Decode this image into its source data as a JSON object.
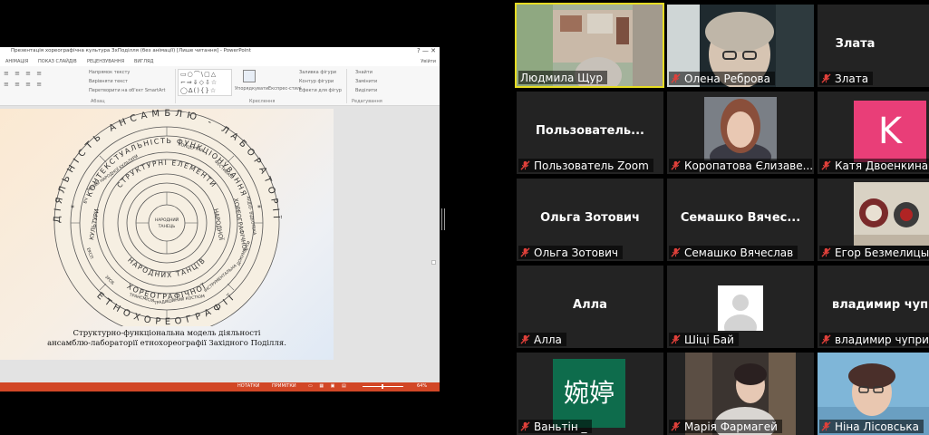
{
  "share": {
    "window_title": "Презентація хореографічна культура ЗхПоділля (без анімації) [Лише читання] - PowerPoint",
    "window_controls": "?  —  ✕",
    "user": "Увійти",
    "tabs": [
      "АНІМАЦІЯ",
      "ПОКАЗ СЛАЙДІВ",
      "РЕЦЕНЗУВАННЯ",
      "ВИГЛЯД"
    ],
    "ribbon": {
      "text_direction": "Напрямок тексту",
      "align_text": "Вирівняти текст",
      "smartart": "Перетворити на об'єкт SmartArt",
      "group_paragraph": "Абзац",
      "arrange": "Упорядкувати",
      "quick_styles": "Експрес-стилі",
      "shape_fill": "Заливка фігури",
      "shape_outline": "Контур фігури",
      "shape_effects": "Ефекти для фігур",
      "group_drawing": "Креслення",
      "find": "Знайти",
      "replace": "Замінити",
      "select": "Виділити",
      "group_editing": "Редагування"
    },
    "slide": {
      "caption_line1": "Структурно-функціональна модель діяльності",
      "caption_line2": "ансамблю-лабораторії етнохореографії Західного Поділля.",
      "ring_outer_top": "ДІЯЛЬНІСТЬ АНСАМБЛЮ - ЛАБОРАТОРІЇ",
      "ring_outer_bottom": "ЕТНОХОРЕОГРАФІЇ",
      "ring2_top": "КОНТЕКСТУАЛЬНІСТЬ ФУНКЦІОНУВАННЯ",
      "ring2_bottom": "ХОРЕОГРАФІЧНОЇ",
      "ring3_top": "СТРУКТУРНІ ЕЛЕМЕНТИ",
      "ring3_bottom": "НАРОДНИХ ТАНЦІВ",
      "center_line1": "НАРОДНИЙ",
      "center_line2": "ТАНЕЦЬ",
      "ring_side_left": "КУЛЬТУРИ",
      "ring_side_right": "НАРОДНОЇ",
      "ring2_side_right": "ХОРЕОГРАФІЧНОЇ",
      "segments": [
        "МУЗЕЙ НАРОДНОЇ КУЛЬТУРИ",
        "КОНЦЕРТНА",
        "ФЕСТИВАЛІ",
        "АУДІО- ВІДЕОТЕКА",
        "ДОКУМЕНТИ",
        "ІНСТРУМЕНТАЛЬНА",
        "ТРАДИЦІЙНИЙ КОСТЮМ",
        "ТРАНСМІСІЯ",
        "ЗРОБ",
        "ЕКСП",
        "ВЧ"
      ]
    },
    "status": {
      "notes": "НОТАТКИ",
      "comments": "ПРИМІТКИ",
      "zoom": "64%"
    }
  },
  "participants": [
    {
      "name": "Людмила Щур",
      "big_label": "",
      "active": true,
      "kind": "video1"
    },
    {
      "name": "Олена Реброва",
      "big_label": "",
      "active": false,
      "kind": "video2"
    },
    {
      "name": "Злата",
      "big_label": "Злата",
      "active": false,
      "kind": "text"
    },
    {
      "name": "Пользователь Zoom",
      "big_label": "Пользователь...",
      "active": false,
      "kind": "text"
    },
    {
      "name": "Коропатова Єлизаве...",
      "big_label": "",
      "active": false,
      "kind": "photo-girl"
    },
    {
      "name": "Катя Двоенкина",
      "big_label": "",
      "active": false,
      "kind": "avatar-k",
      "avatar": "K"
    },
    {
      "name": "Ольга Зотович",
      "big_label": "Ольга Зотович",
      "active": false,
      "kind": "text"
    },
    {
      "name": "Семашко Вячеслав",
      "big_label": "Семашко  Вячес...",
      "active": false,
      "kind": "text"
    },
    {
      "name": "Егор Безмелицын",
      "big_label": "",
      "active": false,
      "kind": "photo-egor"
    },
    {
      "name": "Алла",
      "big_label": "Алла",
      "active": false,
      "kind": "text"
    },
    {
      "name": "Шіці Бай",
      "big_label": "",
      "active": false,
      "kind": "avatar-default"
    },
    {
      "name": "владимир чуприна",
      "big_label": "владимир  чуп",
      "active": false,
      "kind": "text"
    },
    {
      "name": "Ваньтін _",
      "big_label": "",
      "active": false,
      "kind": "avatar-chinese",
      "avatar": "婉婷"
    },
    {
      "name": "Марія Фармагей",
      "big_label": "",
      "active": false,
      "kind": "video-maria"
    },
    {
      "name": "Ніна Лісовська",
      "big_label": "",
      "active": false,
      "kind": "video-nina"
    }
  ],
  "colors": {
    "active_border": "#e6dc23",
    "muted_mic": "#e0403a",
    "ppt_status": "#d24726",
    "tile_bg": "#232323"
  },
  "icons": {
    "muted": "microphone-muted-icon"
  }
}
